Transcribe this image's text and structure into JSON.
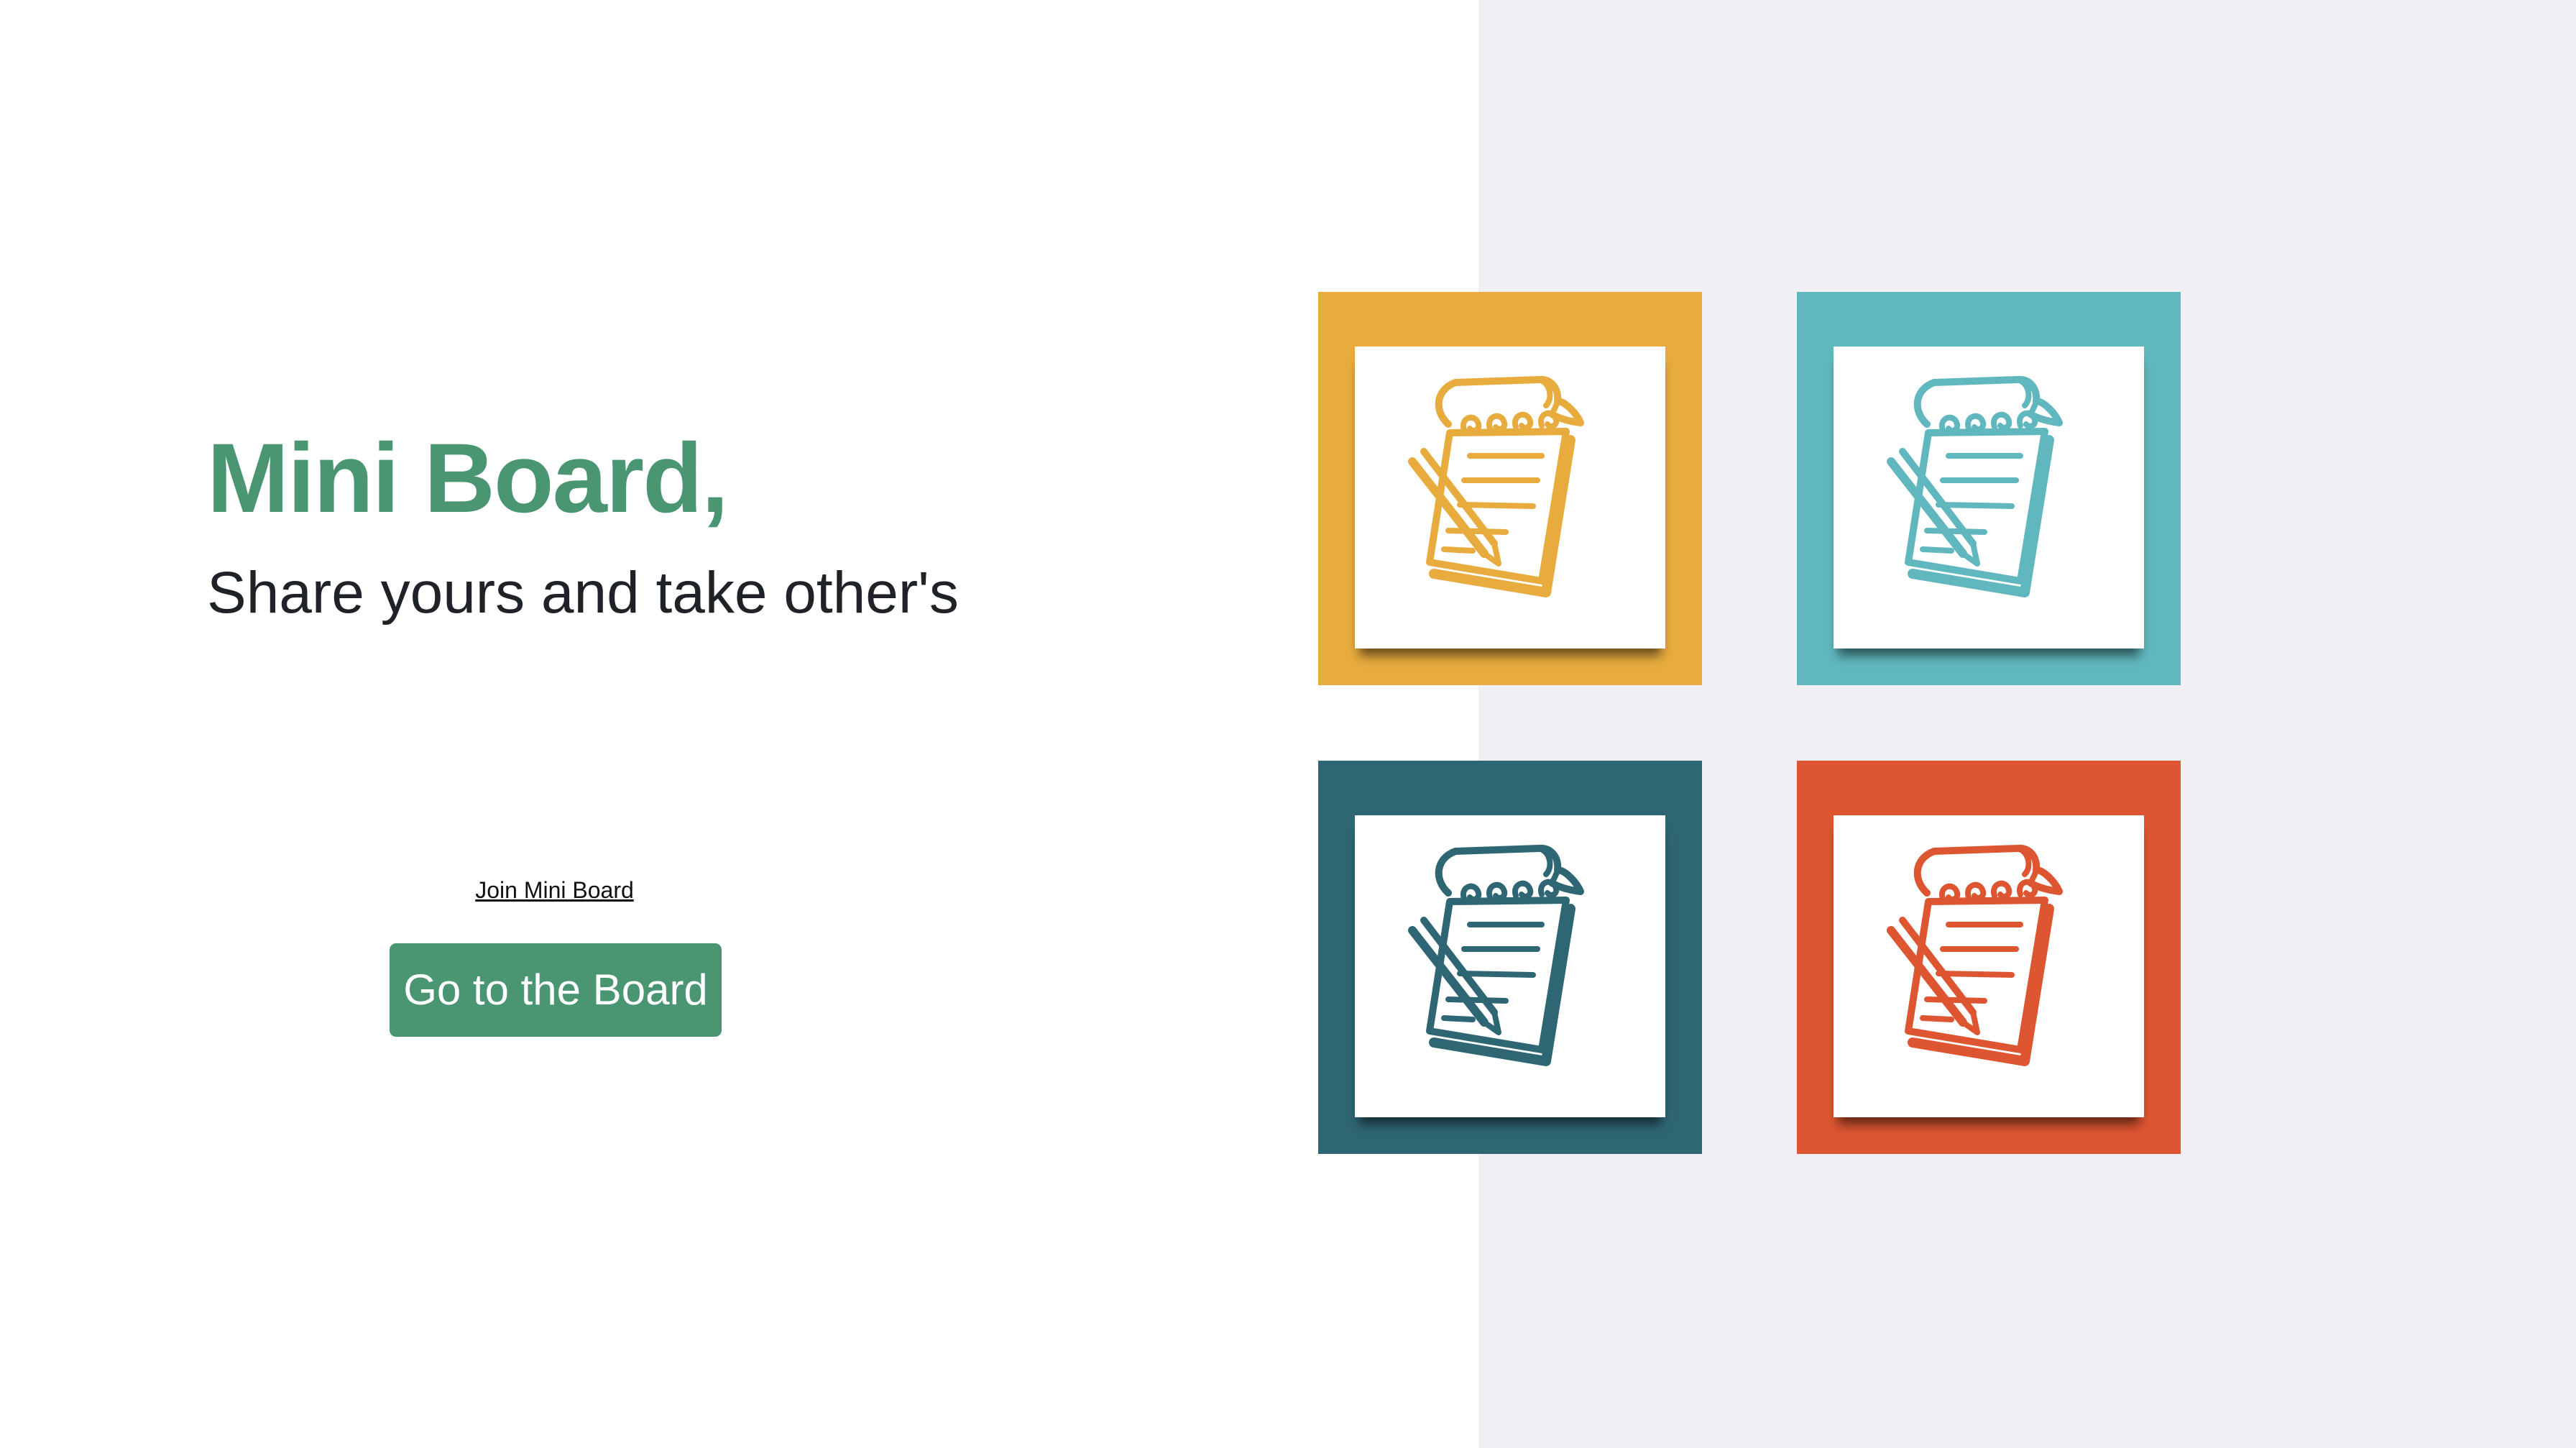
{
  "hero": {
    "title": "Mini Board,",
    "subtitle": "Share yours and take other's"
  },
  "actions": {
    "join_link": "Join Mini Board",
    "cta_button": "Go to the Board"
  },
  "colors": {
    "brand_green": "#4a9673",
    "right_panel_bg": "#f1eff4"
  },
  "tiles": [
    {
      "icon": "notepad-icon",
      "color": "#e8ac3e"
    },
    {
      "icon": "notepad-icon",
      "color": "#60b8be"
    },
    {
      "icon": "notepad-icon",
      "color": "#2f6674"
    },
    {
      "icon": "notepad-icon",
      "color": "#de5631"
    }
  ]
}
